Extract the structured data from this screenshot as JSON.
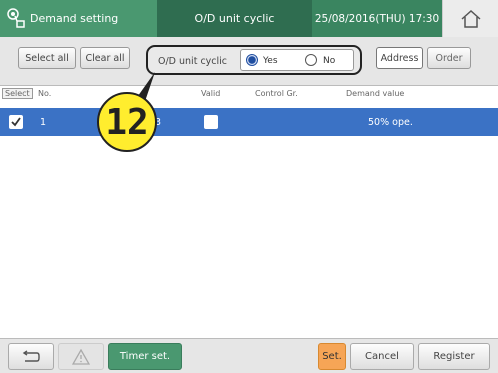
{
  "header": {
    "title": "Demand setting",
    "mode": "O/D unit cyclic",
    "datetime": "25/08/2016(THU) 17:30",
    "home_icon": "home-icon",
    "app_icon": "demand-icon"
  },
  "toolbar": {
    "select_all": "Select all",
    "clear_all": "Clear all",
    "od_unit_label": "O/D unit cyclic",
    "yes_label": "Yes",
    "no_label": "No",
    "selected_option": "Yes",
    "address": "Address",
    "order": "Order"
  },
  "table": {
    "headers": {
      "select": "Select",
      "no": "No.",
      "valid": "Valid",
      "control_gr": "Control Gr.",
      "demand_value": "Demand value"
    },
    "rows": [
      {
        "selected": true,
        "no": "1",
        "address": "3",
        "valid": false,
        "demand": "50% ope."
      }
    ]
  },
  "callout": {
    "number": "12"
  },
  "footer": {
    "back_icon": "back-arrow-icon",
    "warning_icon": "warning-icon",
    "timer": "Timer set.",
    "set": "Set.",
    "cancel": "Cancel",
    "register": "Register"
  },
  "colors": {
    "title_green": "#4a9870",
    "title_dark_green": "#2f6d50",
    "row_blue": "#3b72c5",
    "set_orange": "#f6a556",
    "callout_yellow": "#ffed2e"
  }
}
